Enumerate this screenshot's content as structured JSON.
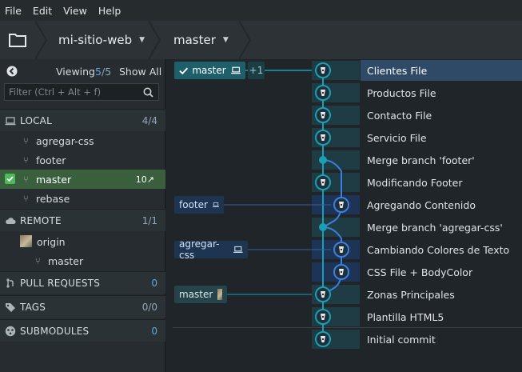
{
  "menu": [
    "File",
    "Edit",
    "View",
    "Help"
  ],
  "toolbar": {
    "repo": "mi-sitio-web",
    "branch": "master"
  },
  "left": {
    "viewing_label": "Viewing",
    "viewing_count": "5",
    "viewing_total": "/5",
    "show_all": "Show All",
    "filter_placeholder": "Filter (Ctrl + Alt + f)",
    "local": {
      "label": "LOCAL",
      "count": "4/4",
      "branches": [
        "agregar-css",
        "footer",
        "master",
        "rebase"
      ],
      "master_badge": "10↗"
    },
    "remote": {
      "label": "REMOTE",
      "count": "1/1",
      "origin": "origin",
      "origin_branch": "master"
    },
    "pull_requests": {
      "label": "PULL REQUESTS",
      "count": "0"
    },
    "tags": {
      "label": "TAGS",
      "count": "0/0"
    },
    "submodules": {
      "label": "SUBMODULES",
      "count": "0"
    }
  },
  "graph": {
    "head_label": "master",
    "plus_label": "+1",
    "footer_label": "footer",
    "agregar_label": "agregar-css",
    "remote_master_label": "master",
    "commits": [
      "Clientes File",
      "Productos File",
      "Contacto File",
      "Servicio File",
      "Merge branch 'footer'",
      "Modificando Footer",
      "Agregando Contenido",
      "Merge branch 'agregar-css'",
      "Cambiando Colores de Texto",
      "CSS File + BodyColor",
      "Zonas Principales",
      "Plantilla HTML5",
      "Initial commit"
    ]
  },
  "colors": {
    "teal": "#1a9fb4",
    "blue": "#3b7fe0",
    "selected": "#2f4a66",
    "active_branch": "#3a5f3d"
  }
}
